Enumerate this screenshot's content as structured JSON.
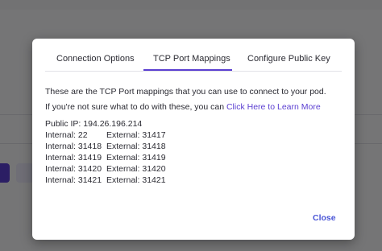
{
  "modal": {
    "tabs": [
      "Connection Options",
      "TCP Port Mappings",
      "Configure Public Key"
    ],
    "active_tab_index": 1,
    "intro_text": "These are the TCP Port mappings that you can use to connect to your pod.",
    "help_prefix": "If you're not sure what to do with these, you can ",
    "help_link": "Click Here to Learn More",
    "public_ip_label": "Public IP: 194.26.196.214",
    "mappings": [
      {
        "internal": "Internal: 22",
        "external": "External: 31417"
      },
      {
        "internal": "Internal: 31418",
        "external": "External: 31418"
      },
      {
        "internal": "Internal: 31419",
        "external": "External: 31419"
      },
      {
        "internal": "Internal: 31420",
        "external": "External: 31420"
      },
      {
        "internal": "Internal: 31421",
        "external": "External: 31421"
      }
    ],
    "close_label": "Close"
  },
  "colors": {
    "accent": "#5b3fd1",
    "close": "#4a55d6",
    "overlay": "rgba(0,0,0,0.52)"
  }
}
